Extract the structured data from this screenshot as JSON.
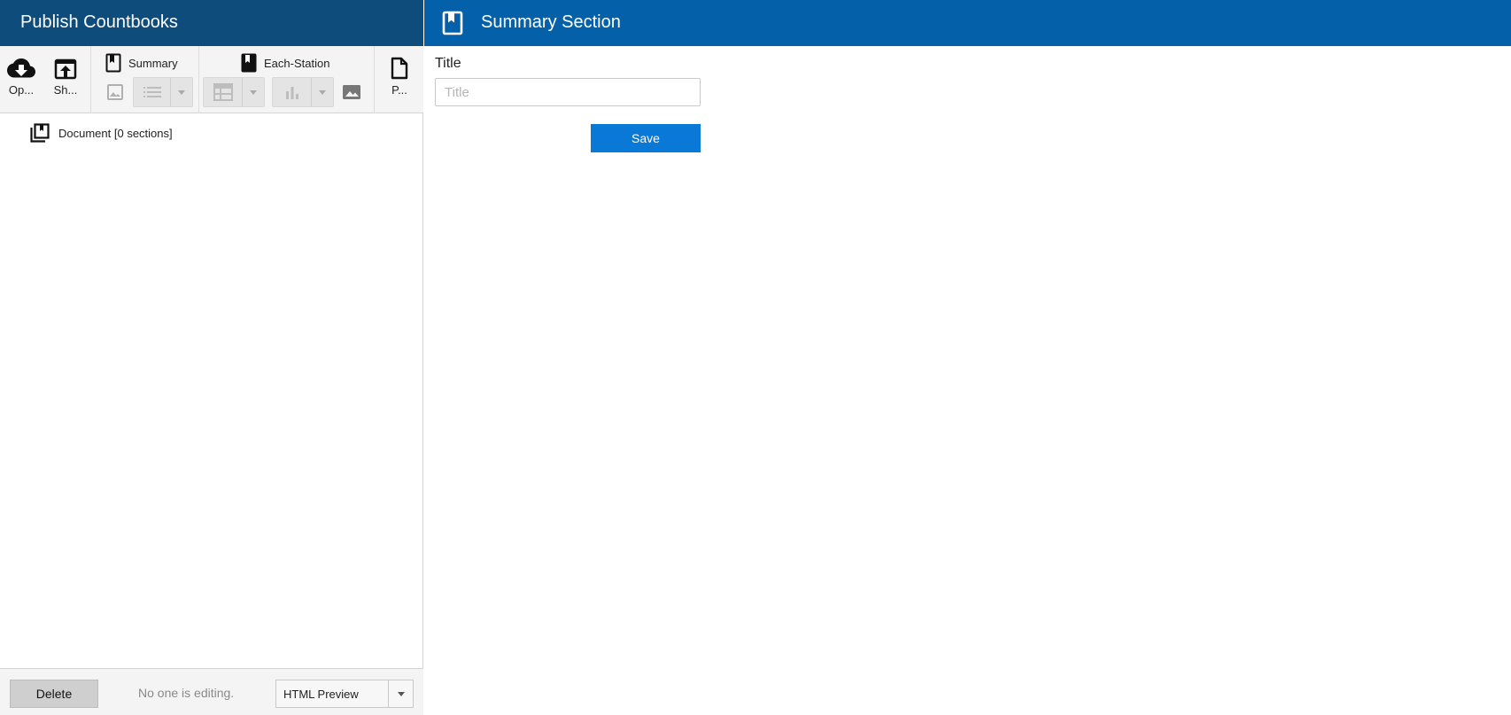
{
  "left_header": {
    "title": "Publish Countbooks"
  },
  "toolbar": {
    "open_label": "Op...",
    "share_label": "Sh...",
    "summary_label": "Summary",
    "each_station_label": "Each-Station",
    "publish_label": "P..."
  },
  "tree": {
    "document_label": "Document [0 sections]"
  },
  "footer": {
    "delete_label": "Delete",
    "editing_status": "No one is editing.",
    "preview_value": "HTML Preview"
  },
  "right_header": {
    "title": "Summary Section"
  },
  "form": {
    "title_label": "Title",
    "title_placeholder": "Title",
    "title_value": "",
    "save_label": "Save"
  },
  "colors": {
    "left_header_bg": "#0e4c7c",
    "right_header_bg": "#0460a8",
    "save_button_bg": "#0a78d6"
  },
  "icons": [
    "cloud-download-icon",
    "open-in-browser-icon",
    "bookmark-icon",
    "image-icon",
    "list-icon",
    "table-icon",
    "bar-chart-icon",
    "document-icon",
    "library-books-icon"
  ]
}
